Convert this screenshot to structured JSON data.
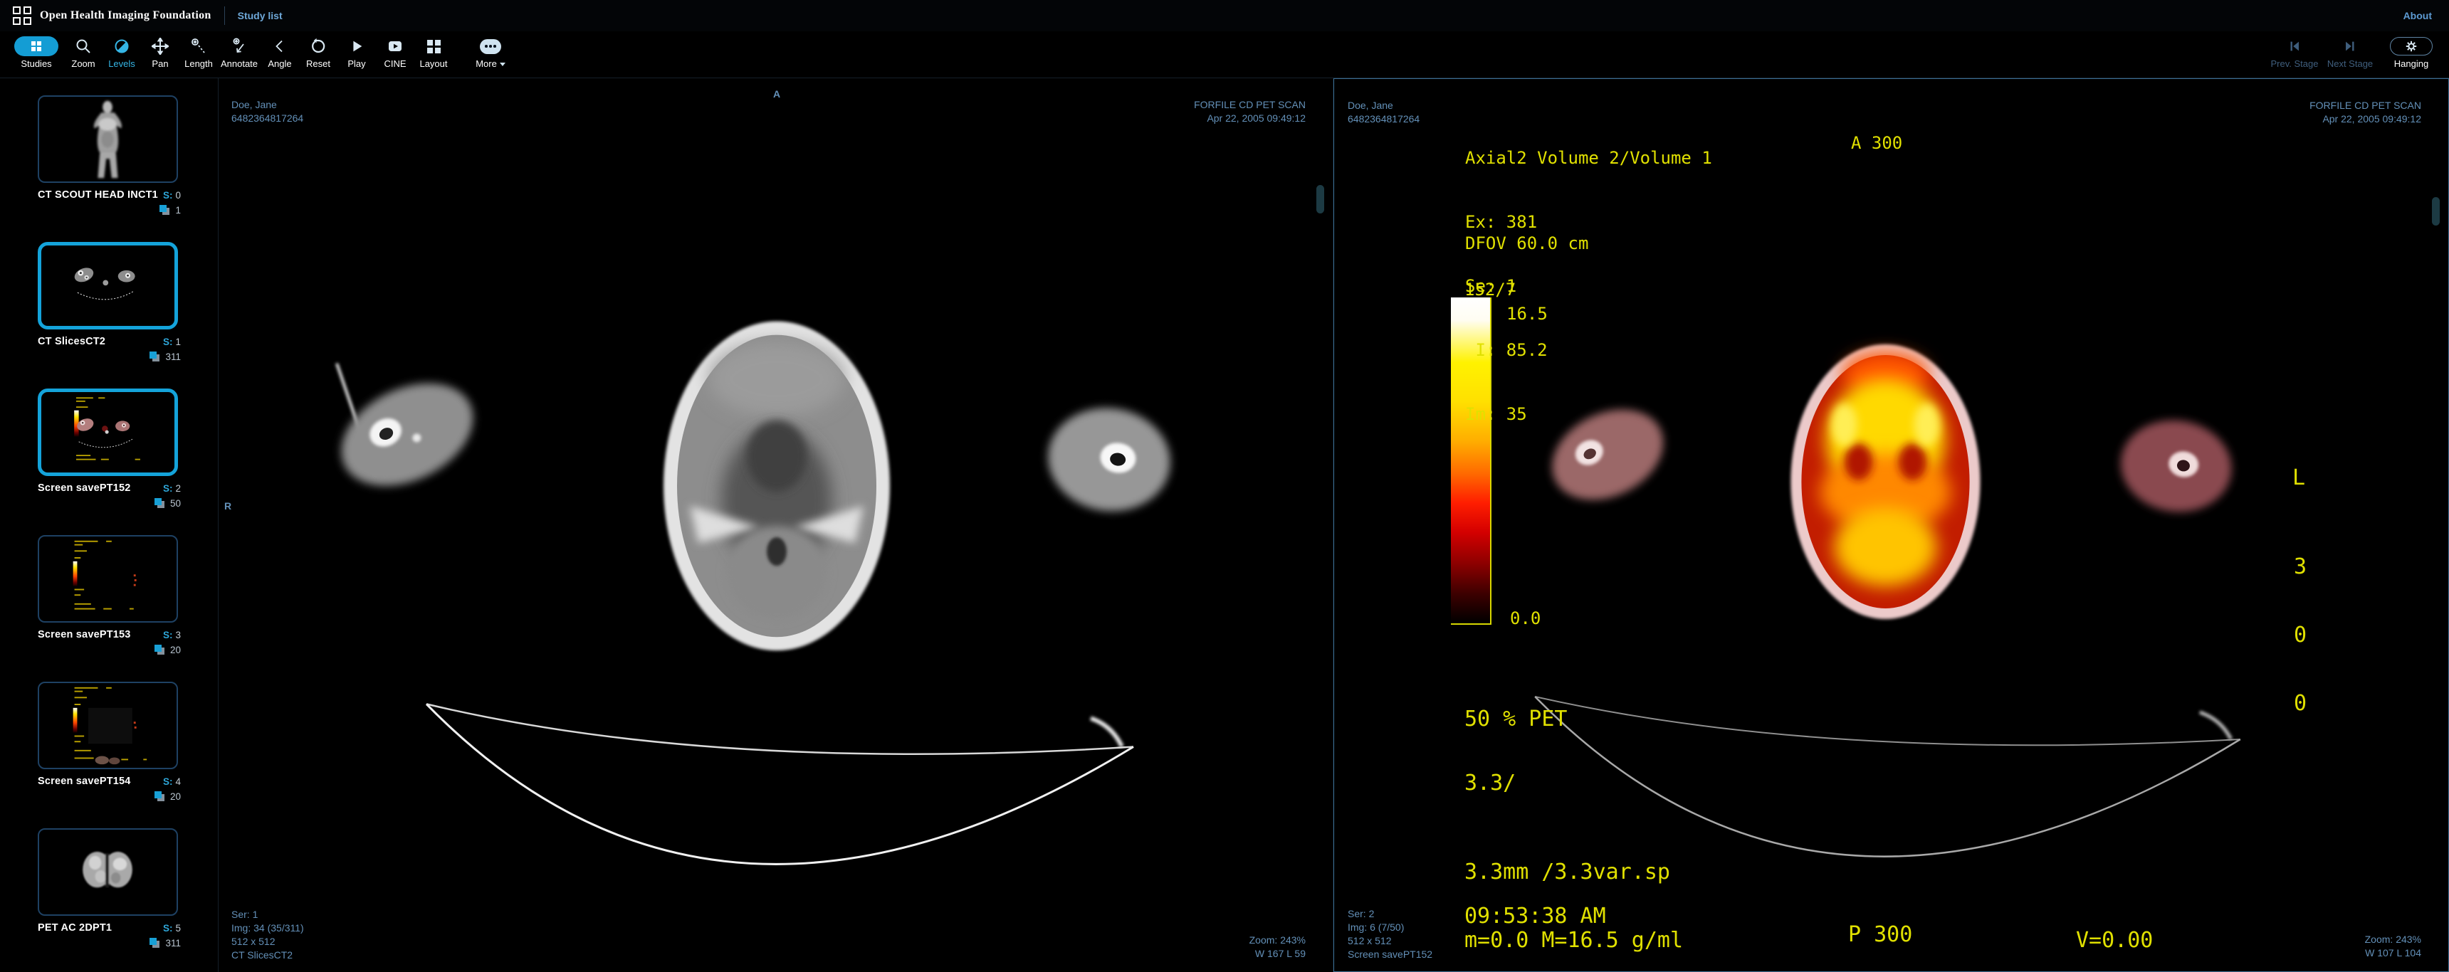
{
  "header": {
    "logo_text": "Open Health Imaging Foundation",
    "study_list_label": "Study list",
    "about_label": "About"
  },
  "toolbar": {
    "buttons": [
      {
        "id": "studies",
        "label": "Studies"
      },
      {
        "id": "zoom",
        "label": "Zoom"
      },
      {
        "id": "levels",
        "label": "Levels",
        "active": true
      },
      {
        "id": "pan",
        "label": "Pan"
      },
      {
        "id": "length",
        "label": "Length"
      },
      {
        "id": "annotate",
        "label": "Annotate"
      },
      {
        "id": "angle",
        "label": "Angle"
      },
      {
        "id": "reset",
        "label": "Reset"
      },
      {
        "id": "play",
        "label": "Play"
      },
      {
        "id": "cine",
        "label": "CINE"
      },
      {
        "id": "layout",
        "label": "Layout"
      },
      {
        "id": "more",
        "label": "More"
      }
    ],
    "stage": {
      "prev_label": "Prev. Stage",
      "next_label": "Next Stage",
      "hanging_label": "Hanging"
    }
  },
  "sidebar": {
    "items": [
      {
        "label": "CT SCOUT HEAD INCT1",
        "series_key": "S:",
        "series_num": "0",
        "count": "1",
        "type": "ct-scout-body",
        "selected": false
      },
      {
        "label": "CT SlicesCT2",
        "series_key": "S:",
        "series_num": "1",
        "count": "311",
        "type": "ct-axial-slice",
        "selected": true
      },
      {
        "label": "Screen savePT152",
        "series_key": "S:",
        "series_num": "2",
        "count": "50",
        "type": "fused-pet-ct",
        "selected": true
      },
      {
        "label": "Screen savePT153",
        "series_key": "S:",
        "series_num": "3",
        "count": "20",
        "type": "pet-screen-save",
        "selected": false
      },
      {
        "label": "Screen savePT154",
        "series_key": "S:",
        "series_num": "4",
        "count": "20",
        "type": "pet-screen-save",
        "selected": false
      },
      {
        "label": "PET AC 2DPT1",
        "series_key": "S:",
        "series_num": "5",
        "count": "311",
        "type": "pet-brain",
        "selected": false
      }
    ]
  },
  "viewport_left": {
    "patient_name": "Doe, Jane",
    "patient_id": "6482364817264",
    "study": "FORFILE CD PET SCAN",
    "study_date": "Apr 22, 2005 09:49:12",
    "marker_top": "A",
    "marker_left": "R",
    "ser": "Ser: 1",
    "img": "Img: 34 (35/311)",
    "dims": "512 x 512",
    "series_desc": "CT SlicesCT2",
    "zoom": "Zoom: 243%",
    "wl": "W 167 L 59"
  },
  "viewport_right": {
    "patient_name": "Doe, Jane",
    "patient_id": "6482364817264",
    "study": "FORFILE CD PET SCAN",
    "study_date": "Apr 22, 2005 09:49:12",
    "info_line1": "Axial2 Volume 2/Volume 1",
    "info_line2": "Ex: 381",
    "info_line3": "Se: 1",
    "info_line4": " I: 85.2",
    "info_line5": "Im: 35",
    "dfov": "DFOV 60.0 cm",
    "marker_anterior": "A 300",
    "marker_left_letter": "L",
    "marker_left_d1": "3",
    "marker_left_d2": "0",
    "marker_left_d3": "0",
    "marker_posterior": "P 300",
    "colorbar_top_label": "152/7",
    "colorbar_max": "16.5",
    "colorbar_min": "0.0",
    "pet_percent": "50 % PET",
    "slice_thickness": "3.3/",
    "recon": "3.3mm /3.3var.sp",
    "acq_time": "09:53:38 AM",
    "minmax": "m=0.0 M=16.5 g/ml",
    "v_value": "V=0.00",
    "ser": "Ser: 2",
    "img": "Img: 6 (7/50)",
    "dims": "512 x 512",
    "series_desc": "Screen savePT152",
    "zoom": "Zoom: 243%",
    "wl": "W 107 L 104"
  },
  "colors": {
    "accent": "#149dd4",
    "accent-light": "#35b5e5",
    "overlay-blue": "#6390b8",
    "pet-yellow": "#e0e000",
    "stage-disabled": "#3f5e7d",
    "link-blue": "#6ea8d8"
  }
}
